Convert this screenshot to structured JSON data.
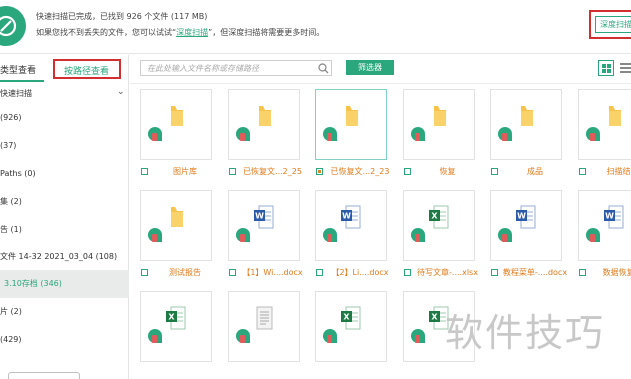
{
  "header": {
    "line1": "快速扫描已完成，已找到 926 个文件 (117 MB)",
    "line2_prefix": "如果您找不到丢失的文件，您可以试试“",
    "line2_link": "深度扫描",
    "line2_suffix": "”，但深度扫描将需要更多时间。",
    "deep_scan_button": "深度扫描"
  },
  "left_panel": {
    "tab_type": "类型查看",
    "tab_path": "按路径查看",
    "tree_root": "快速扫描",
    "items": [
      "(926)",
      "(37)",
      "Paths (0)",
      "集 (2)",
      "告 (1)",
      "文件 14-32 2021_03_04 (108)",
      "3.10存档 (346)",
      "片 (2)",
      "(429)"
    ],
    "selected_index": 6
  },
  "toolbar": {
    "search_placeholder": "在此处输入文件名称或存储路径",
    "filter_button": "筛选器"
  },
  "grid": {
    "rows": [
      [
        {
          "name": "图片库",
          "icon": "folder-icon",
          "checked": false
        },
        {
          "name": "已恢复文...2_25",
          "icon": "folder-icon",
          "checked": false
        },
        {
          "name": "已恢复文...2_23",
          "icon": "folder-icon",
          "checked": true
        },
        {
          "name": "恢复",
          "icon": "folder-icon",
          "checked": false
        },
        {
          "name": "成品",
          "icon": "folder-icon",
          "checked": false
        },
        {
          "name": "扫描结果",
          "icon": "folder-icon",
          "checked": false
        }
      ],
      [
        {
          "name": "测试报告",
          "icon": "folder-icon",
          "checked": false
        },
        {
          "name": "【1】Wi....docx",
          "icon": "word-icon",
          "checked": false
        },
        {
          "name": "【2】Li....docx",
          "icon": "word-icon",
          "checked": false
        },
        {
          "name": "待写文章-....xlsx",
          "icon": "excel-icon",
          "checked": false
        },
        {
          "name": "教程菜单-....docx",
          "icon": "word-icon",
          "checked": false
        },
        {
          "name": "数据恢复...",
          "icon": "word-icon",
          "checked": false
        }
      ],
      [
        {
          "name": "",
          "icon": "excel-icon",
          "checked": false
        },
        {
          "name": "",
          "icon": "doc-icon",
          "checked": false
        },
        {
          "name": "",
          "icon": "excel-icon",
          "checked": false
        },
        {
          "name": "",
          "icon": "excel-icon",
          "checked": false
        }
      ]
    ]
  },
  "watermark": "软件技巧",
  "colors": {
    "accent": "#2aa77c",
    "highlight_box": "#d32f2f",
    "file_name": "#e07a1a",
    "folder": "#f7c34a",
    "word": "#2b5aa8",
    "excel": "#1e7a45"
  }
}
